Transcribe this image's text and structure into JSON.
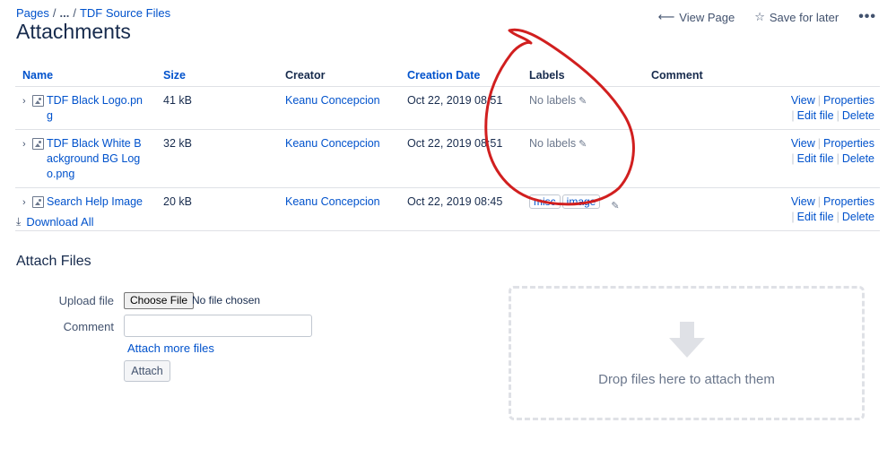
{
  "breadcrumb": {
    "pages": "Pages",
    "sep1": "/",
    "ellipsis": "...",
    "sep2": "/",
    "current": "TDF Source Files"
  },
  "page": {
    "title": "Attachments"
  },
  "actions": {
    "view_page": "View Page",
    "save_for_later": "Save for later",
    "more": "•••"
  },
  "table": {
    "headers": {
      "name": "Name",
      "size": "Size",
      "creator": "Creator",
      "creation_date": "Creation Date",
      "labels": "Labels",
      "comment": "Comment"
    },
    "rows": [
      {
        "name": "TDF Black Logo.png",
        "size": "41 kB",
        "creator": "Keanu Concepcion",
        "date": "Oct 22, 2019 08:51",
        "labels_text": "No labels",
        "tags": []
      },
      {
        "name": "TDF Black White Background BG Logo.png",
        "size": "32 kB",
        "creator": "Keanu Concepcion",
        "date": "Oct 22, 2019 08:51",
        "labels_text": "No labels",
        "tags": []
      },
      {
        "name": "Search Help Image",
        "size": "20 kB",
        "creator": "Keanu Concepcion",
        "date": "Oct 22, 2019 08:45",
        "labels_text": "",
        "tags": [
          "misc",
          "image"
        ]
      }
    ],
    "row_actions": {
      "view": "View",
      "properties": "Properties",
      "edit_file": "Edit file",
      "delete": "Delete",
      "separator": "|"
    }
  },
  "download_all": "Download All",
  "attach": {
    "title": "Attach Files",
    "upload_label": "Upload file",
    "choose_file": "Choose File",
    "no_file": "No file chosen",
    "comment_label": "Comment",
    "comment_value": "",
    "attach_more": "Attach more files",
    "attach_button": "Attach",
    "drop_text": "Drop files here to attach them"
  },
  "colors": {
    "link": "#0052cc",
    "annotation": "#d11f1f",
    "text": "#172b4d"
  }
}
